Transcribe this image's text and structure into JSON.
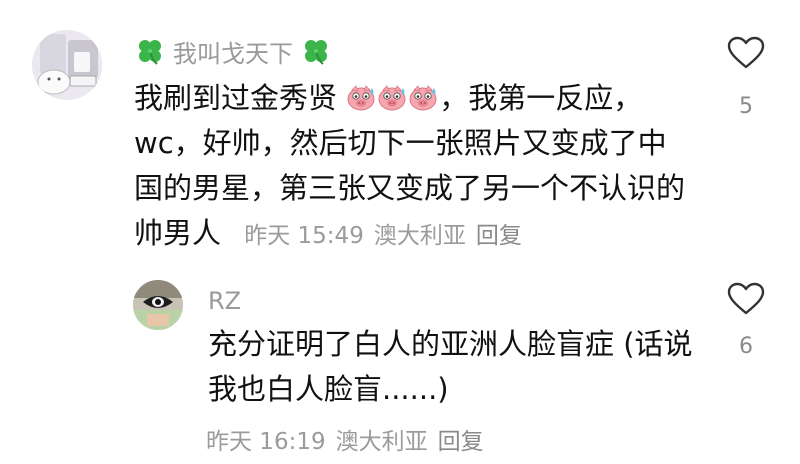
{
  "comments": [
    {
      "username": "我叫戈天下",
      "content_lines": [
        "我刷到过金秀贤",
        "，我第一反应，",
        "wc，好帅，然后切下一张照片又变成了中",
        "国的男星，第三张又变成了另一个不认识的",
        "帅男人"
      ],
      "time": "昨天 15:49",
      "location": "澳大利亚",
      "reply_label": "回复",
      "likes": "5",
      "emoji_name": "sweating-pig-face-icon"
    },
    {
      "username": "RZ",
      "content_lines": [
        "充分证明了白人的亚洲人脸盲症 (话说",
        "我也白人脸盲......)"
      ],
      "time": "昨天 16:19",
      "location": "澳大利亚",
      "reply_label": "回复",
      "likes": "6"
    }
  ],
  "colors": {
    "username": "#9a9a9a",
    "text": "#111111",
    "meta": "#9b9b9b",
    "clover": "#3bb54a"
  }
}
